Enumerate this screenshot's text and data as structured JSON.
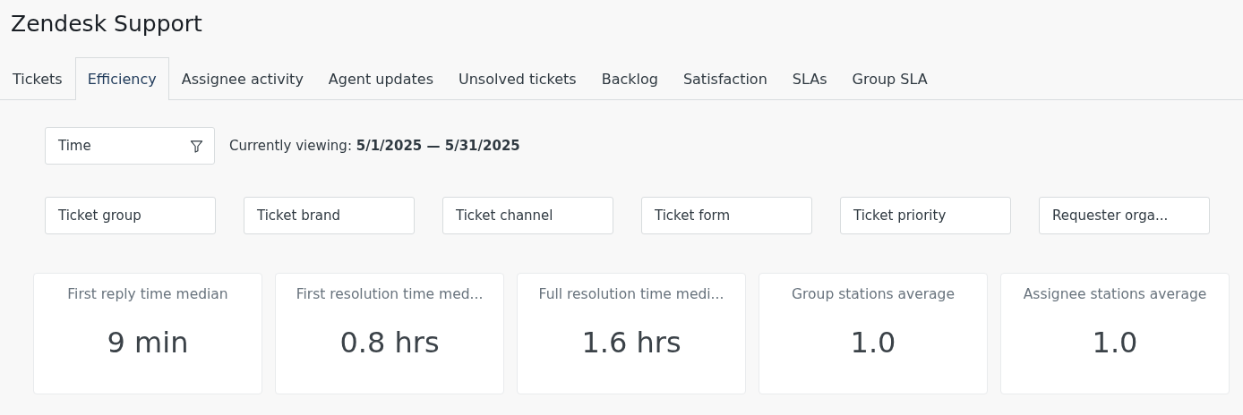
{
  "window": {
    "title": "Zendesk Support"
  },
  "tabs": [
    {
      "label": "Tickets",
      "selected": false
    },
    {
      "label": "Efficiency",
      "selected": true
    },
    {
      "label": "Assignee activity",
      "selected": false
    },
    {
      "label": "Agent updates",
      "selected": false
    },
    {
      "label": "Unsolved tickets",
      "selected": false
    },
    {
      "label": "Backlog",
      "selected": false
    },
    {
      "label": "Satisfaction",
      "selected": false
    },
    {
      "label": "SLAs",
      "selected": false
    },
    {
      "label": "Group SLA",
      "selected": false
    }
  ],
  "time_filter": {
    "label": "Time",
    "viewing": "Currently viewing: **5/1/2025 — 5/31/2025**"
  },
  "filters": [
    "Ticket group",
    "Ticket brand",
    "Ticket channel",
    "Ticket form",
    "Ticket priority",
    "Requester orga..."
  ],
  "metrics": [
    {
      "title": "First reply time median",
      "value": "9 min"
    },
    {
      "title": "First resolution time med...",
      "value": "0.8 hrs"
    },
    {
      "title": "Full resolution time medi...",
      "value": "1.6 hrs"
    },
    {
      "title": "Group stations average",
      "value": "1.0"
    },
    {
      "title": "Assignee stations average",
      "value": "1.0"
    }
  ]
}
